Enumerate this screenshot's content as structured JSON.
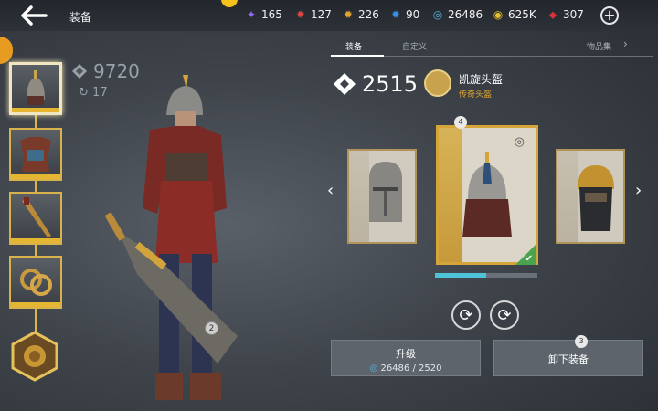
{
  "header": {
    "title": "装备"
  },
  "resources": [
    {
      "icon": "purple-star-icon",
      "value": "165",
      "color": "#8e6bf0"
    },
    {
      "icon": "red-claw-icon",
      "value": "127",
      "color": "#e0463f"
    },
    {
      "icon": "gold-claw-icon",
      "value": "226",
      "color": "#e0a330"
    },
    {
      "icon": "blue-claw-icon",
      "value": "90",
      "color": "#3a8fe0"
    },
    {
      "icon": "swirl-coin-icon",
      "value": "26486",
      "color": "#59b4d8"
    },
    {
      "icon": "gold-coin-icon",
      "value": "625K",
      "color": "#e5c02f"
    },
    {
      "icon": "ruby-icon",
      "value": "307",
      "color": "#d9333a"
    }
  ],
  "character": {
    "power": "9720",
    "sub_value": "17",
    "marker": "2"
  },
  "tabs": [
    {
      "label": "装备",
      "active": true
    },
    {
      "label": "自定义",
      "active": false
    },
    {
      "label": "物品集",
      "active": false
    }
  ],
  "item": {
    "power": "2515",
    "name": "凯旋头盔",
    "rarity": "传奇头盔",
    "card_number": "4",
    "progress": 0.5
  },
  "buttons": {
    "upgrade_label": "升级",
    "upgrade_cost": "26486 / 2520",
    "unequip_label": "卸下装备",
    "unequip_badge": "3"
  },
  "colors": {
    "accent": "#d6a53a",
    "progress": "#4ec2d9",
    "equipped": "#49a34f"
  }
}
